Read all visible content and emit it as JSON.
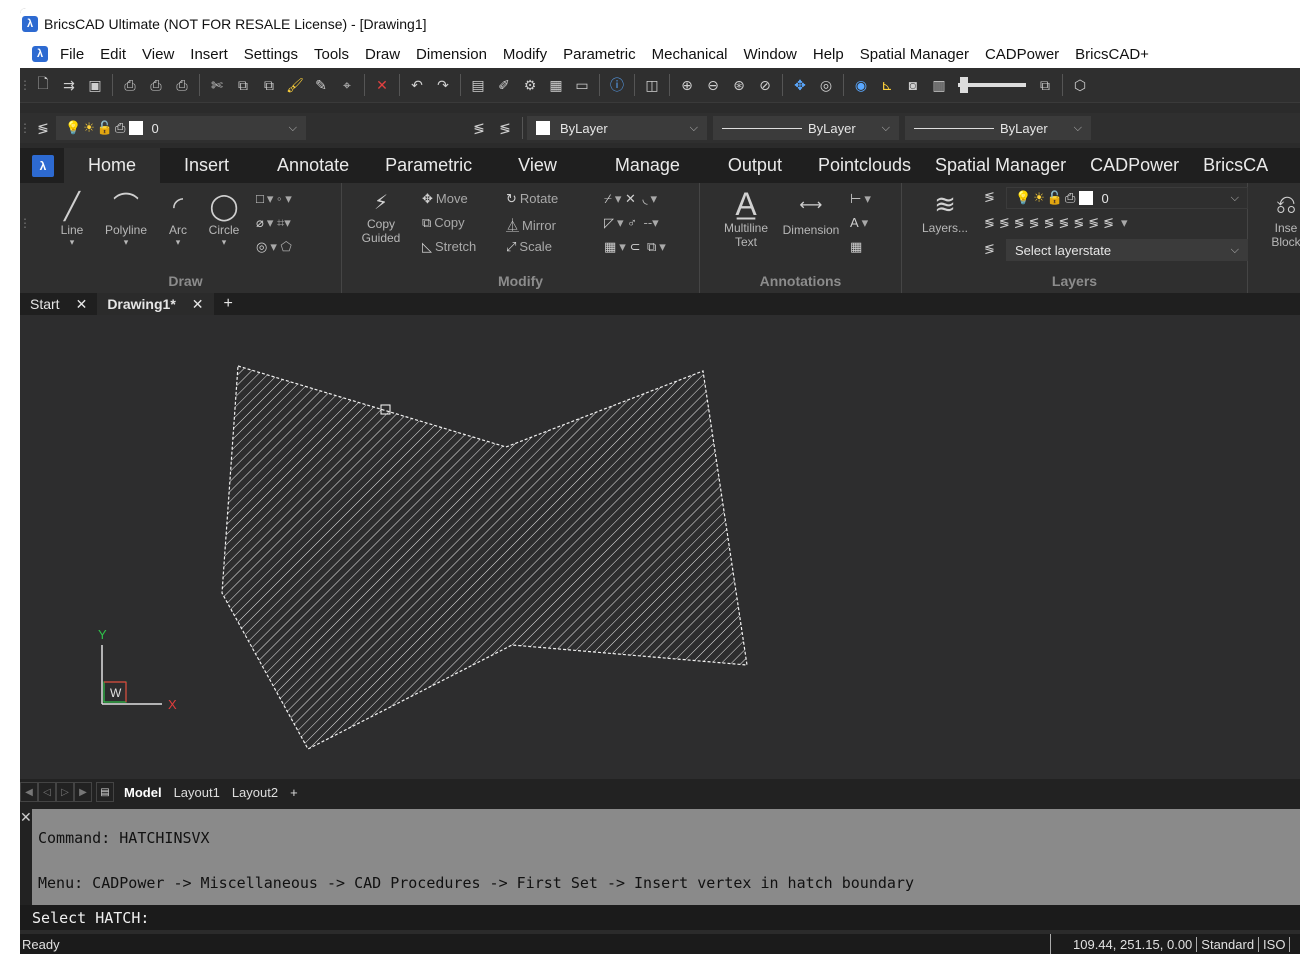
{
  "window": {
    "title": "BricsCAD Ultimate (NOT FOR RESALE License) - [Drawing1]",
    "app_icon_letter": "λ"
  },
  "menu": [
    "File",
    "Edit",
    "View",
    "Insert",
    "Settings",
    "Tools",
    "Draw",
    "Dimension",
    "Modify",
    "Parametric",
    "Mechanical",
    "Window",
    "Help",
    "Spatial Manager",
    "CADPower",
    "BricsCAD+"
  ],
  "layer_toolbar": {
    "layer_name": "0",
    "color": "ByLayer",
    "linetype": "ByLayer",
    "lineweight": "ByLayer"
  },
  "ribbon_tabs": [
    "Home",
    "Insert",
    "Annotate",
    "Parametric",
    "View",
    "Manage",
    "Output",
    "Pointclouds",
    "Spatial Manager",
    "CADPower",
    "BricsCA"
  ],
  "ribbon": {
    "draw": {
      "title": "Draw",
      "line": "Line",
      "polyline": "Polyline",
      "arc": "Arc",
      "circle": "Circle"
    },
    "modify": {
      "title": "Modify",
      "copy_guided_1": "Copy",
      "copy_guided_2": "Guided",
      "move": "Move",
      "copy": "Copy",
      "stretch": "Stretch",
      "rotate": "Rotate",
      "mirror": "Mirror",
      "scale": "Scale"
    },
    "annotations": {
      "title": "Annotations",
      "multiline_1": "Multiline",
      "multiline_2": "Text",
      "dimension": "Dimension"
    },
    "layers": {
      "title": "Layers",
      "layers_btn": "Layers...",
      "layer_value": "0",
      "layerstate": "Select layerstate"
    },
    "insert": {
      "label_1": "Inse",
      "label_2": "Block"
    }
  },
  "doc_tabs": {
    "start": "Start",
    "drawing": "Drawing1*",
    "close": "✕",
    "add": "+"
  },
  "ucs": {
    "y": "Y",
    "x": "X",
    "w": "W"
  },
  "layout_tabs": [
    "Model",
    "Layout1",
    "Layout2",
    "+"
  ],
  "command": {
    "history_1": "Command: HATCHINSVX",
    "history_2": "Menu: CADPower -> Miscellaneous -> CAD Procedures -> First Set -> Insert vertex in hatch boundary",
    "prompt": "Select HATCH:"
  },
  "status": {
    "ready": "Ready",
    "coords": "109.44, 251.15, 0.00",
    "style": "Standard",
    "dimstyle": "ISO"
  },
  "colors": {
    "canvas_bg": "#2d2d2e",
    "ribbon_bg": "#2f2f2f",
    "tab_bar_bg": "#1f1f1f",
    "accent_blue": "#2d6ad1",
    "command_bg": "#8a8a8a"
  }
}
